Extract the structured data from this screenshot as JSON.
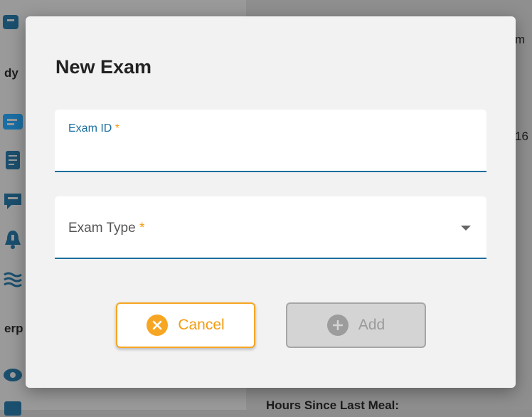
{
  "background": {
    "partial_texts": {
      "top_right": "m",
      "left_heading_1": "dy",
      "right_number": "16",
      "left_heading_2": "erp",
      "bottom_right": "Hours Since Last Meal:"
    }
  },
  "modal": {
    "title": "New Exam",
    "exam_id": {
      "label": "Exam ID",
      "required_mark": "*",
      "value": ""
    },
    "exam_type": {
      "label": "Exam Type",
      "required_mark": "*",
      "selected": ""
    },
    "buttons": {
      "cancel_label": "Cancel",
      "add_label": "Add"
    }
  },
  "colors": {
    "accent_blue": "#1a6e9c",
    "accent_orange": "#f7a623",
    "disabled_gray": "#d4d4d4"
  }
}
